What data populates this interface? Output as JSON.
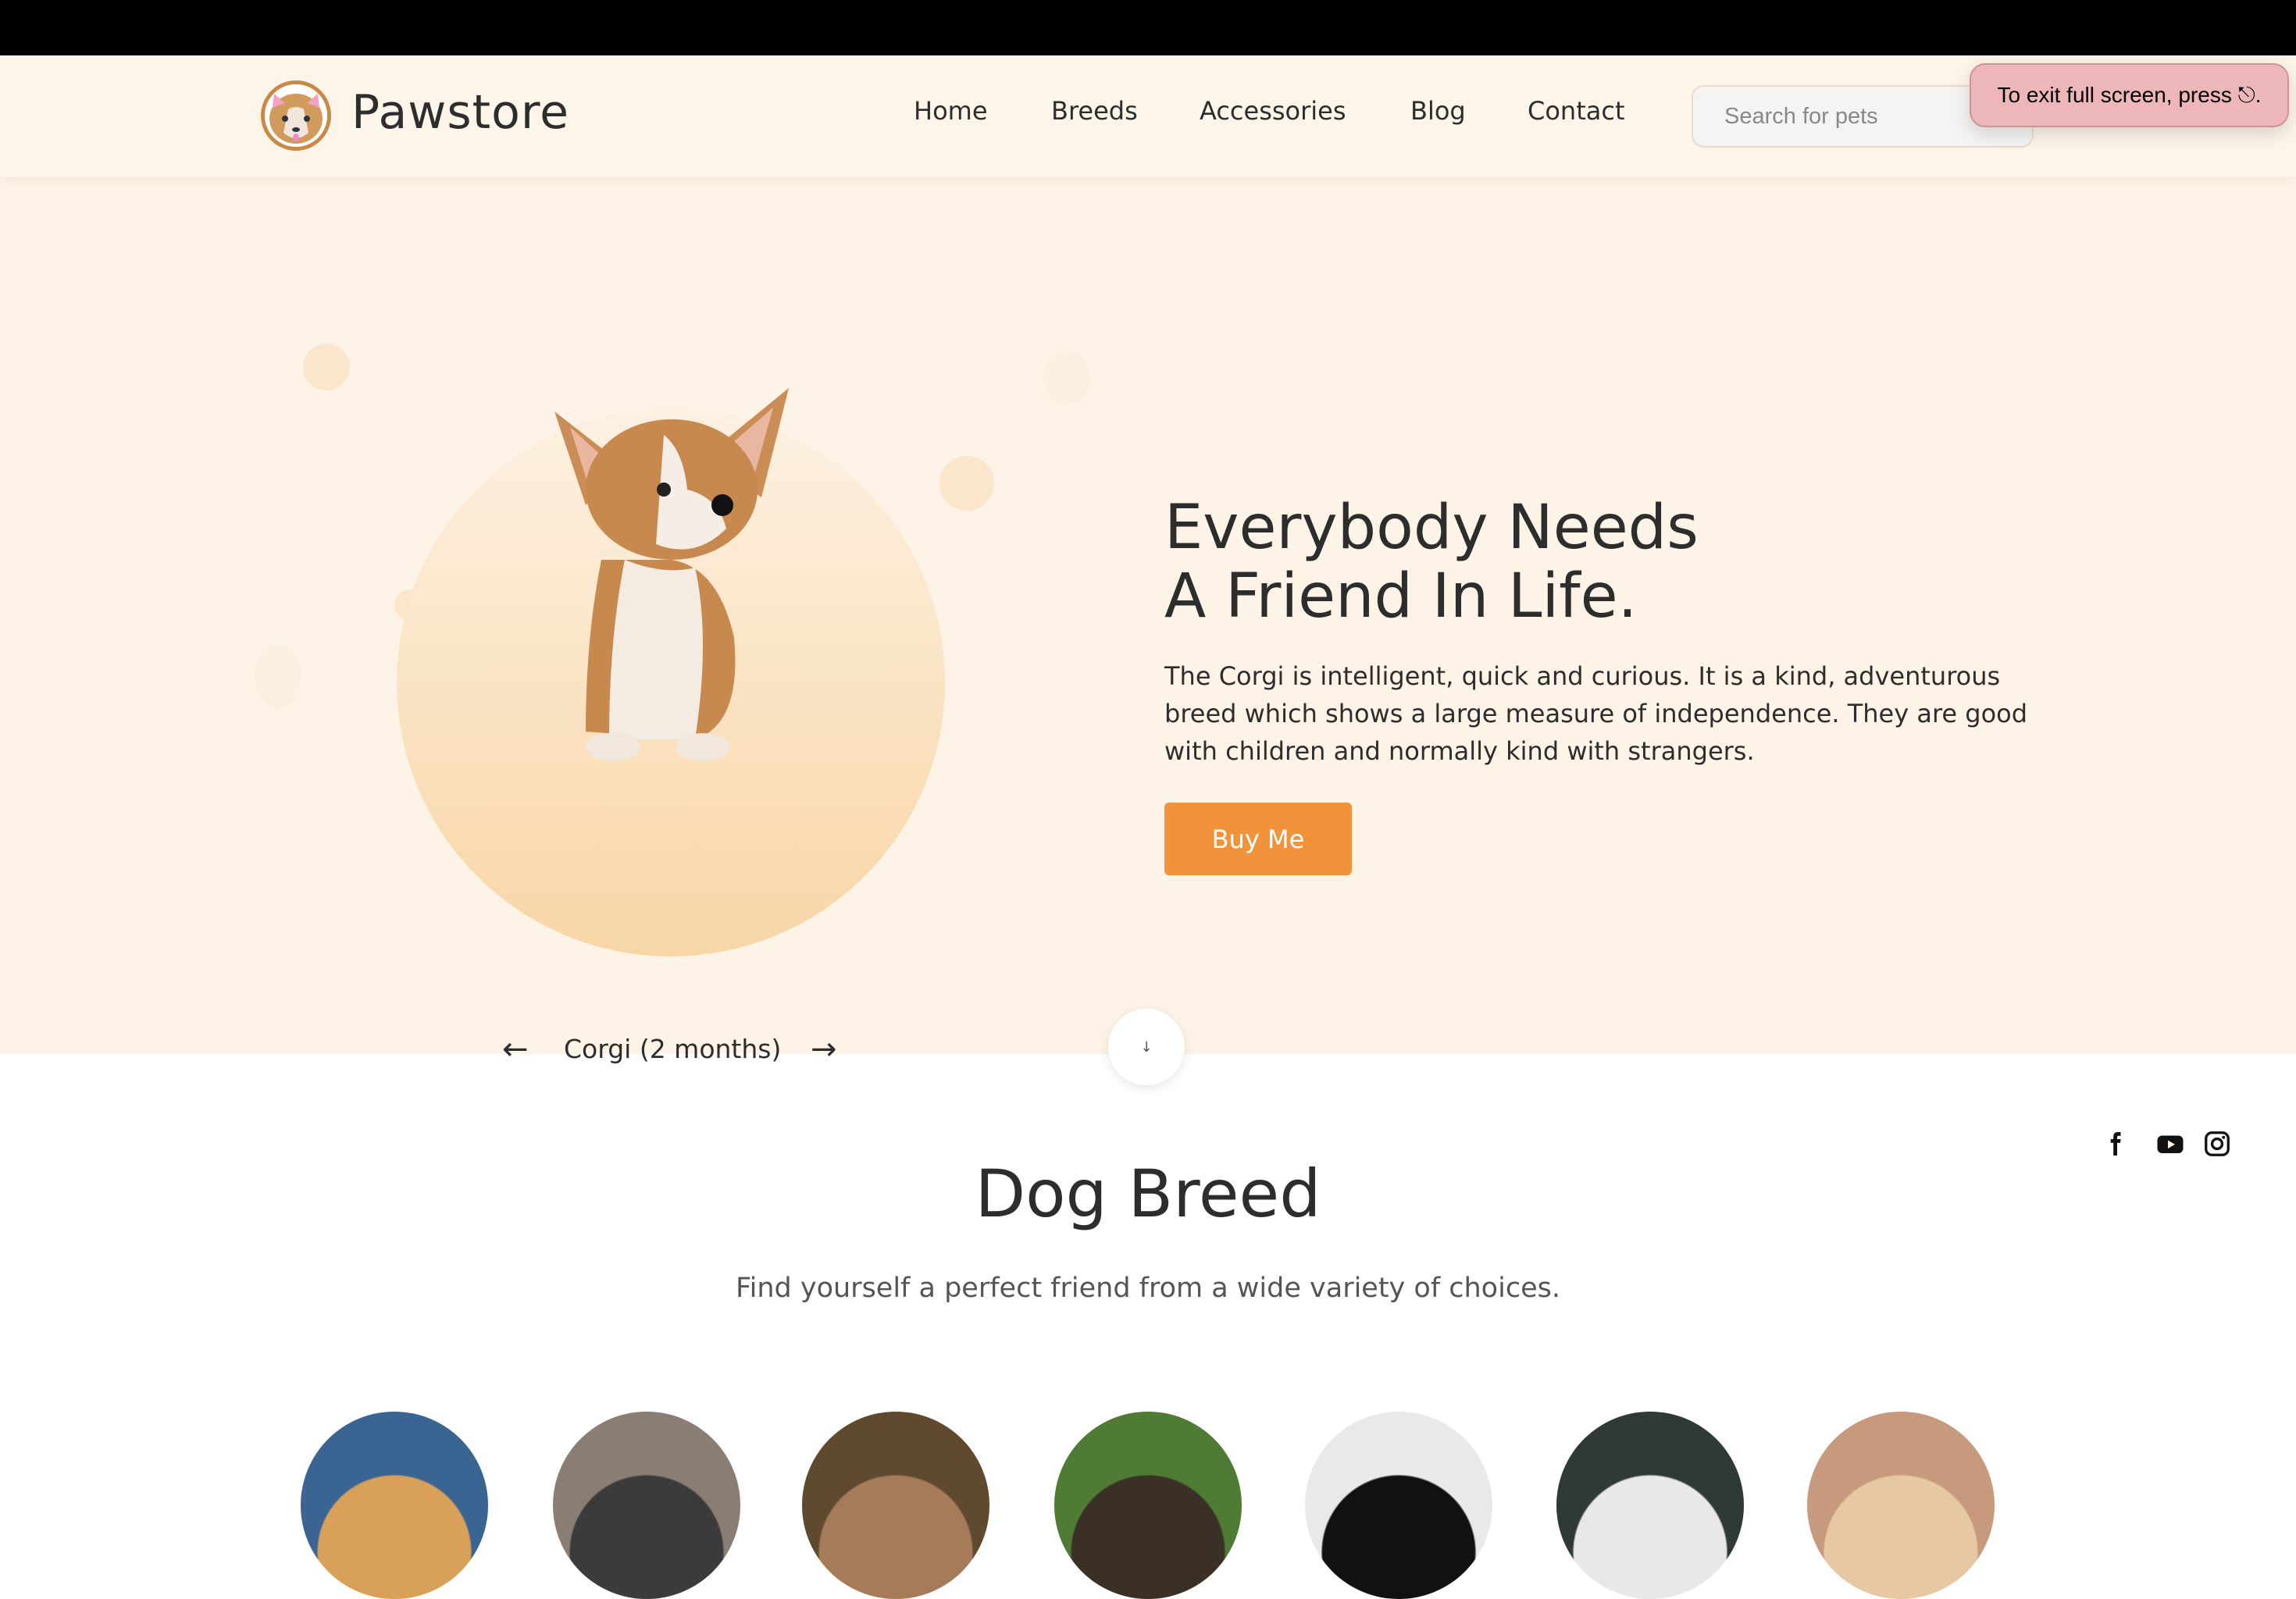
{
  "header": {
    "brand": "Pawstore",
    "nav": [
      "Home",
      "Breeds",
      "Accessories",
      "Blog",
      "Contact"
    ],
    "search_placeholder": "Search for pets"
  },
  "toast": {
    "text": "To exit full screen, press ⎋."
  },
  "hero": {
    "title_line1": "Everybody Needs",
    "title_line2": "A Friend In Life.",
    "description": "The Corgi is intelligent, quick and curious. It is a kind, adventurous breed which shows a large measure of independence. They are good with children and normally kind with strangers.",
    "button": "Buy Me",
    "caption": "Corgi (2 months)",
    "prev_icon": "arrow-left-icon",
    "next_icon": "arrow-right-icon",
    "accent": "#f0933a"
  },
  "social": [
    "facebook-icon",
    "youtube-icon",
    "instagram-icon"
  ],
  "section": {
    "title": "Dog Breed",
    "subtitle": "Find yourself a perfect friend from a wide variety of choices."
  },
  "breeds": [
    {
      "colors": [
        "#3a6592",
        "#d9a05a"
      ]
    },
    {
      "colors": [
        "#8a7d74",
        "#3b3b3b"
      ]
    },
    {
      "colors": [
        "#5f4a2f",
        "#a57b5a"
      ]
    },
    {
      "colors": [
        "#4f7b34",
        "#3a3026"
      ]
    },
    {
      "colors": [
        "#e9e9e9",
        "#111111"
      ]
    },
    {
      "colors": [
        "#2f3a36",
        "#e8e8e8"
      ]
    },
    {
      "colors": [
        "#c79a7e",
        "#e6c9a4"
      ]
    }
  ]
}
